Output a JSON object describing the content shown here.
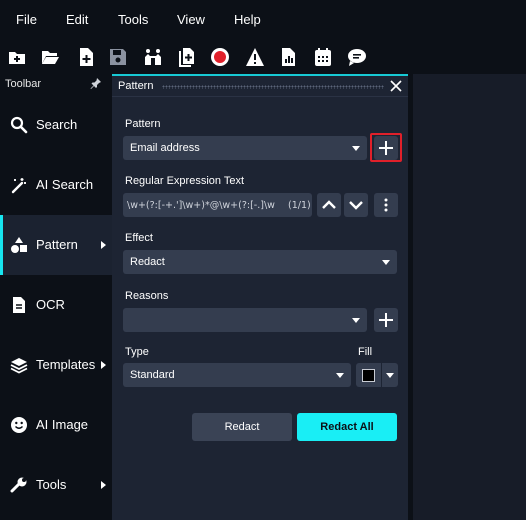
{
  "menu": [
    "File",
    "Edit",
    "Tools",
    "View",
    "Help"
  ],
  "toolbar_icons": [
    "new-folder-icon",
    "open-folder-icon",
    "new-file-icon",
    "save-icon",
    "users-icon",
    "copy-file-icon",
    "record-icon",
    "warning-icon",
    "report-icon",
    "calendar-icon",
    "chat-icon"
  ],
  "sidebar": {
    "header": "Toolbar",
    "items": [
      {
        "label": "Search",
        "icon": "search-icon",
        "arrow": false
      },
      {
        "label": "AI Search",
        "icon": "magic-wand-icon",
        "arrow": false
      },
      {
        "label": "Pattern",
        "icon": "shapes-icon",
        "arrow": true
      },
      {
        "label": "OCR",
        "icon": "document-icon",
        "arrow": false
      },
      {
        "label": "Templates",
        "icon": "layers-icon",
        "arrow": true
      },
      {
        "label": "AI Image",
        "icon": "smiley-icon",
        "arrow": false
      },
      {
        "label": "Tools",
        "icon": "wrench-icon",
        "arrow": true
      }
    ]
  },
  "panel": {
    "title": "Pattern",
    "pattern_label": "Pattern",
    "pattern_value": "Email address",
    "regex_label": "Regular Expression Text",
    "regex_value": "\\w+(?:[-+.']\\w+)*@\\w+(?:[-.]\\w",
    "regex_count": "(1/1)",
    "effect_label": "Effect",
    "effect_value": "Redact",
    "reasons_label": "Reasons",
    "reasons_value": "",
    "type_label": "Type",
    "type_value": "Standard",
    "fill_label": "Fill",
    "fill_color": "#000000",
    "redact_button": "Redact",
    "redact_all_button": "Redact All"
  },
  "colors": {
    "accent": "#19eef5",
    "highlight": "#e0202a",
    "record": "#e0202a"
  }
}
